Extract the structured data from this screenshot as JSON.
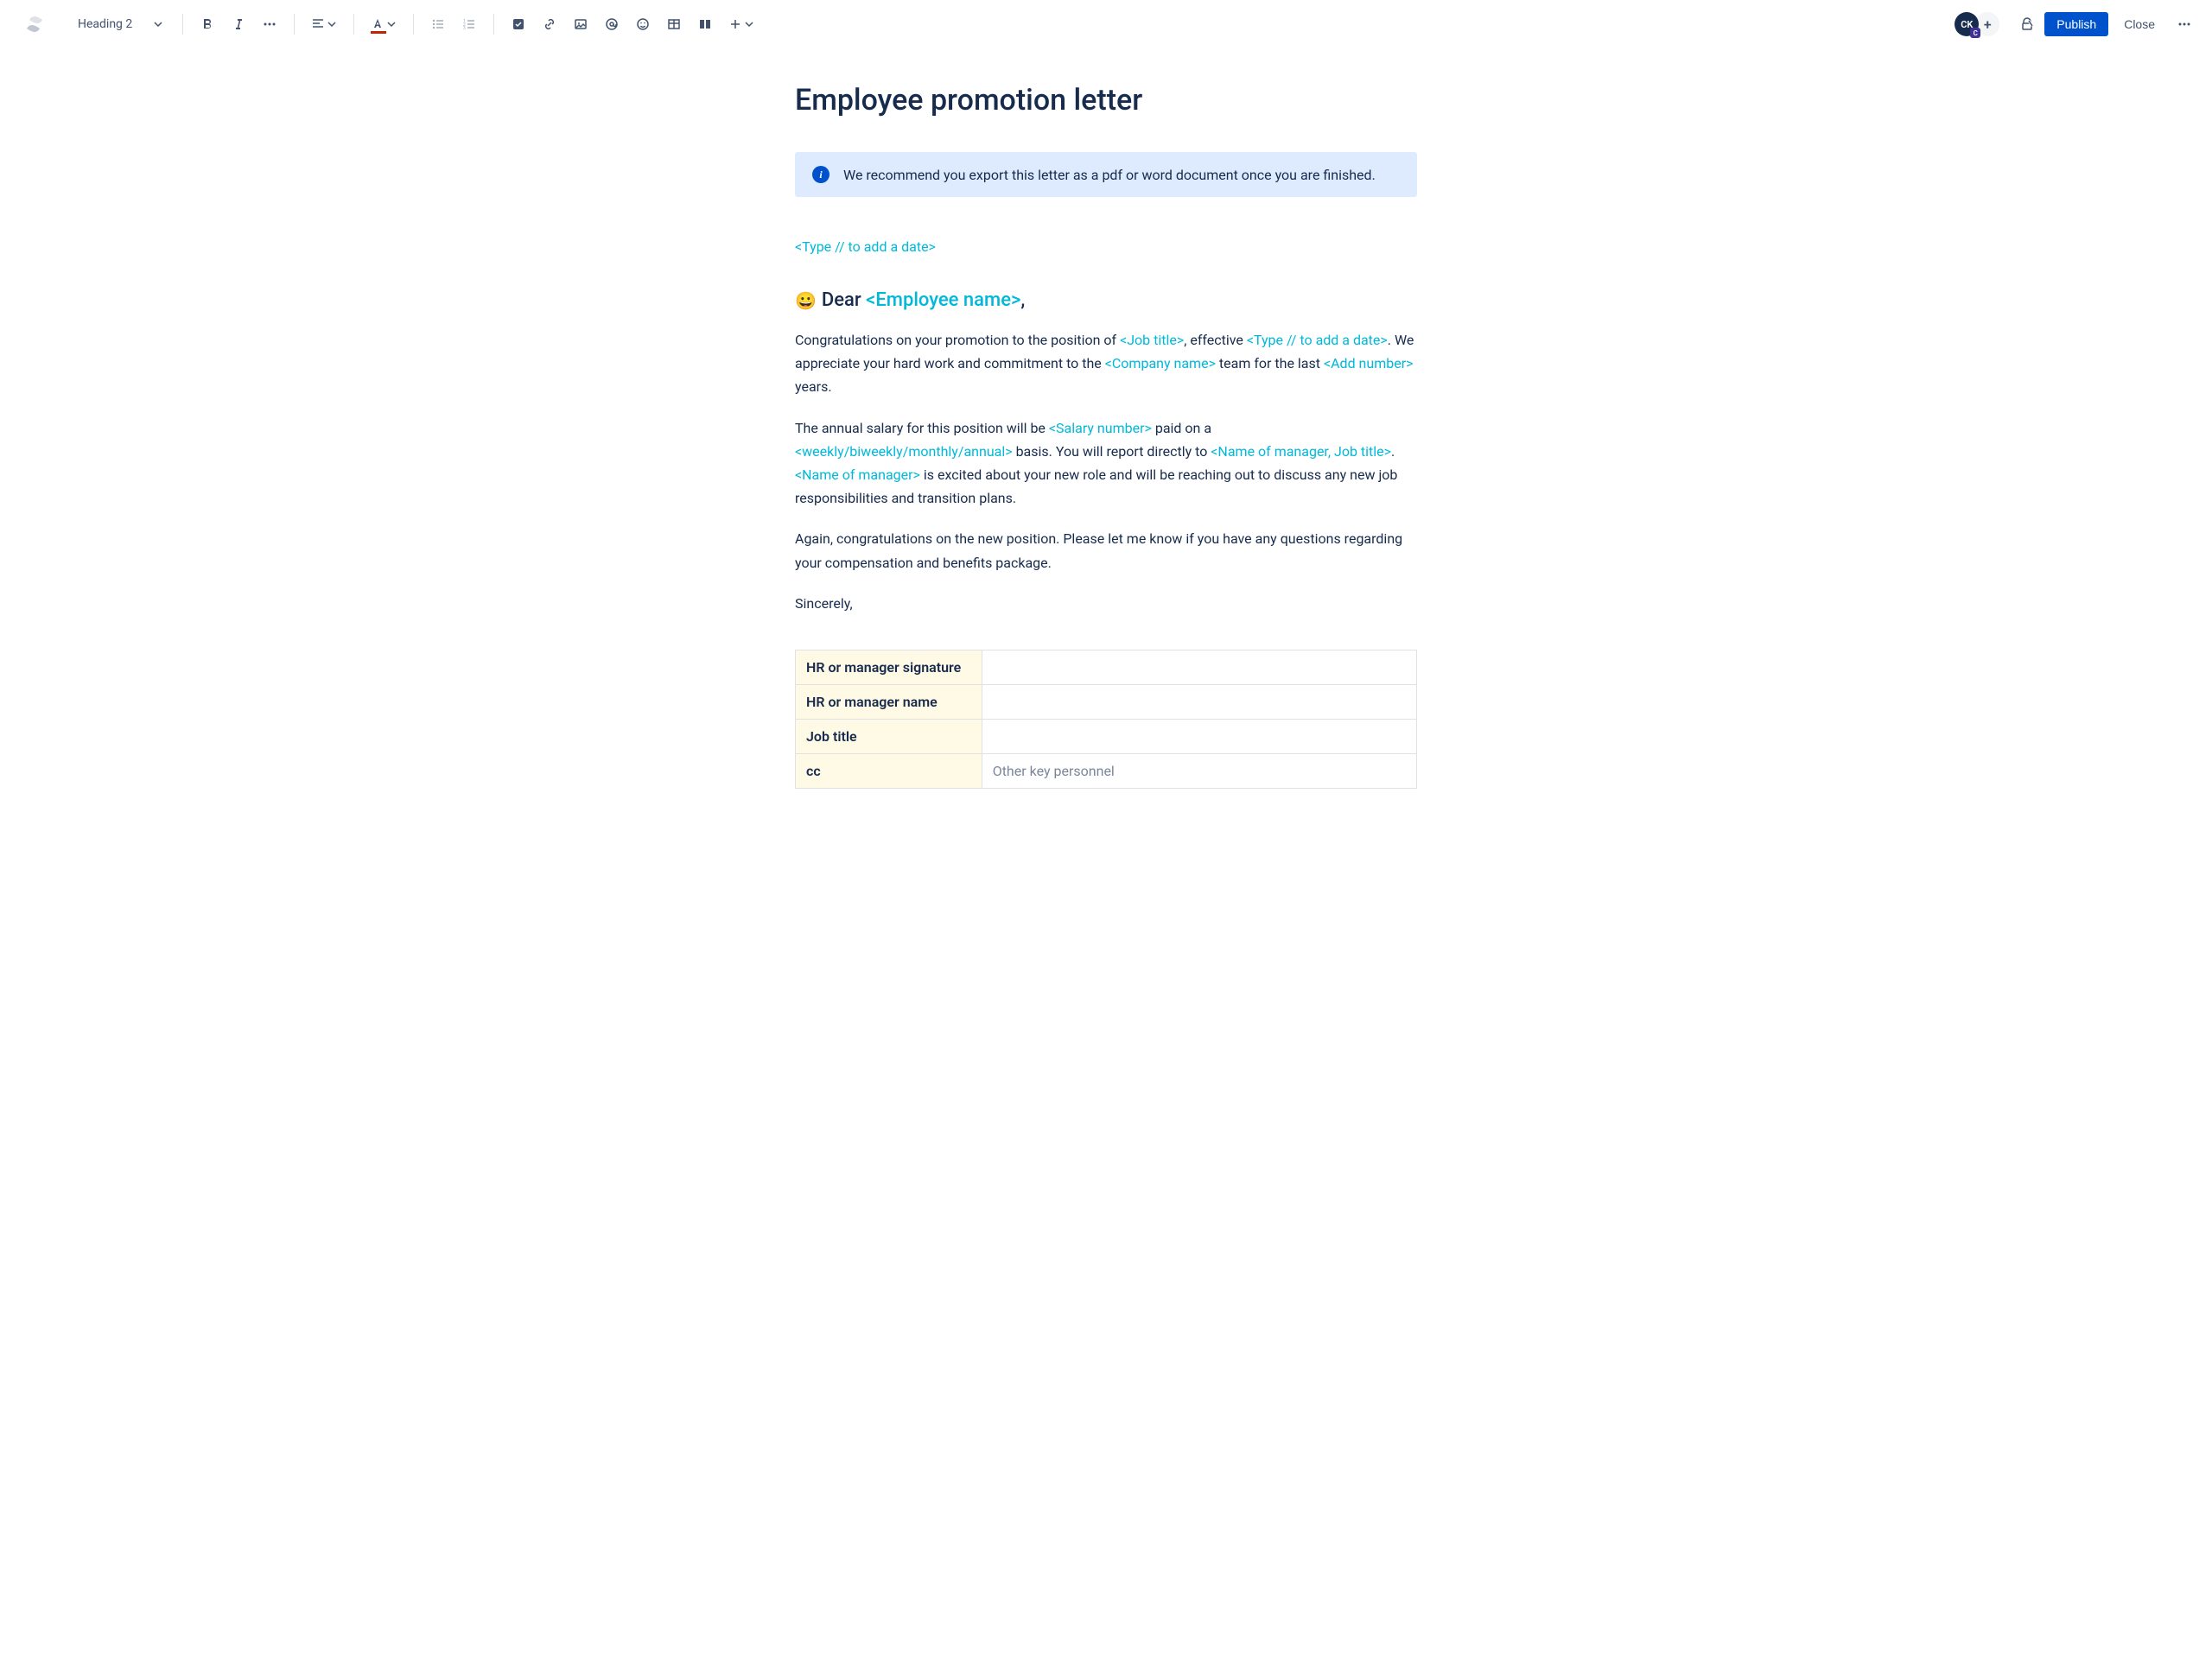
{
  "toolbar": {
    "heading_label": "Heading 2",
    "publish_label": "Publish",
    "close_label": "Close",
    "avatar_initials": "CK"
  },
  "document": {
    "title": "Employee promotion letter",
    "info_panel_text": "We recommend you export this letter as a pdf or word document once you are finished.",
    "date_placeholder": "<Type // to add a date>",
    "greeting_emoji": "😀",
    "greeting_prefix": "Dear ",
    "greeting_name": "<Employee name>",
    "greeting_suffix": ",",
    "para1": {
      "t1": "Congratulations on your promotion to the position of ",
      "p1": "<Job title>",
      "t2": ", effective ",
      "p2": "<Type // to add a date>",
      "t3": ". We appreciate your hard work and commitment to the ",
      "p3": "<Company name>",
      "t4": " team for the last ",
      "p4": "<Add number>",
      "t5": " years."
    },
    "para2": {
      "t1": "The annual salary for this position will be ",
      "p1": "<Salary number>",
      "t2": " paid on a ",
      "p2": "<weekly/biweekly/monthly/annual>",
      "t3": " basis. You will report directly to ",
      "p3": "<Name of manager, Job title>",
      "t4": ". ",
      "p4": "<Name of manager>",
      "t5": " is excited about your new role and will be reaching out to discuss any new job responsibilities and transition plans."
    },
    "para3": "Again, congratulations on the new position. Please let me know if you have any questions regarding your compensation and benefits package.",
    "signoff": "Sincerely,",
    "table": {
      "row1_label": "HR or manager signature",
      "row1_value": "",
      "row2_label": "HR or manager name",
      "row2_value": "",
      "row3_label": "Job title",
      "row3_value": "",
      "row4_label": "cc",
      "row4_value": "Other key personnel"
    }
  }
}
